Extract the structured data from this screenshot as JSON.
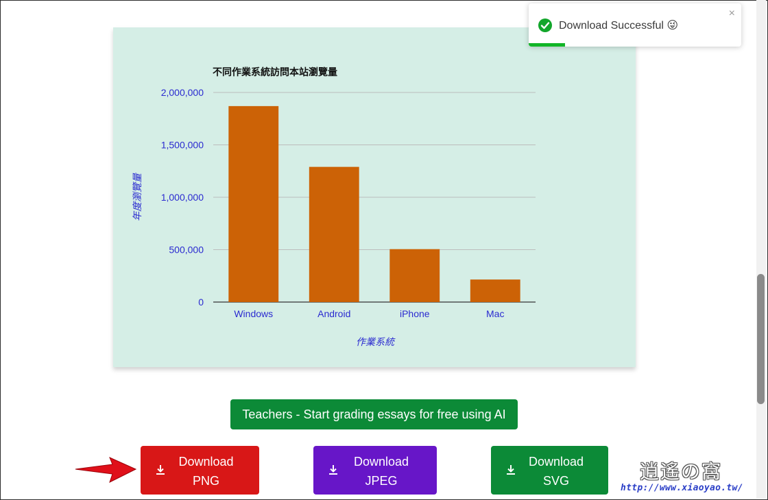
{
  "toast": {
    "message": "Download Successful",
    "emoji": "😜",
    "close_label": "×",
    "icon": "check-circle-icon",
    "progress": 0.17,
    "colors": {
      "icon": "#12a62b",
      "progress": "#11b527"
    }
  },
  "ai_button": {
    "label": "Teachers - Start grading essays for free using AI",
    "color": "#0c8a37"
  },
  "downloads": {
    "png": {
      "line1": "Download",
      "line2": "PNG",
      "color": "#d81717",
      "icon": "download-icon"
    },
    "jpeg": {
      "line1": "Download",
      "line2": "JPEG",
      "color": "#6716c8",
      "icon": "download-icon"
    },
    "svg": {
      "line1": "Download",
      "line2": "SVG",
      "color": "#0c8a37",
      "icon": "download-icon"
    }
  },
  "watermark": {
    "title": "逍遙の窩",
    "url": "http://www.xiaoyao.tw/"
  },
  "chart_data": {
    "type": "bar",
    "title": "不同作業系統訪問本站瀏覽量",
    "xlabel": "作業系統",
    "ylabel": "年度瀏覽量",
    "categories": [
      "Windows",
      "Android",
      "iPhone",
      "Mac"
    ],
    "values": [
      1870000,
      1290000,
      505000,
      215000
    ],
    "ylim": [
      0,
      2000000
    ],
    "yticks": [
      "0",
      "500,000",
      "1,000,000",
      "1,500,000",
      "2,000,000"
    ],
    "grid": true,
    "bar_color": "#cc6206",
    "background": "#d5eee6",
    "label_color": "#2a2ad0"
  }
}
